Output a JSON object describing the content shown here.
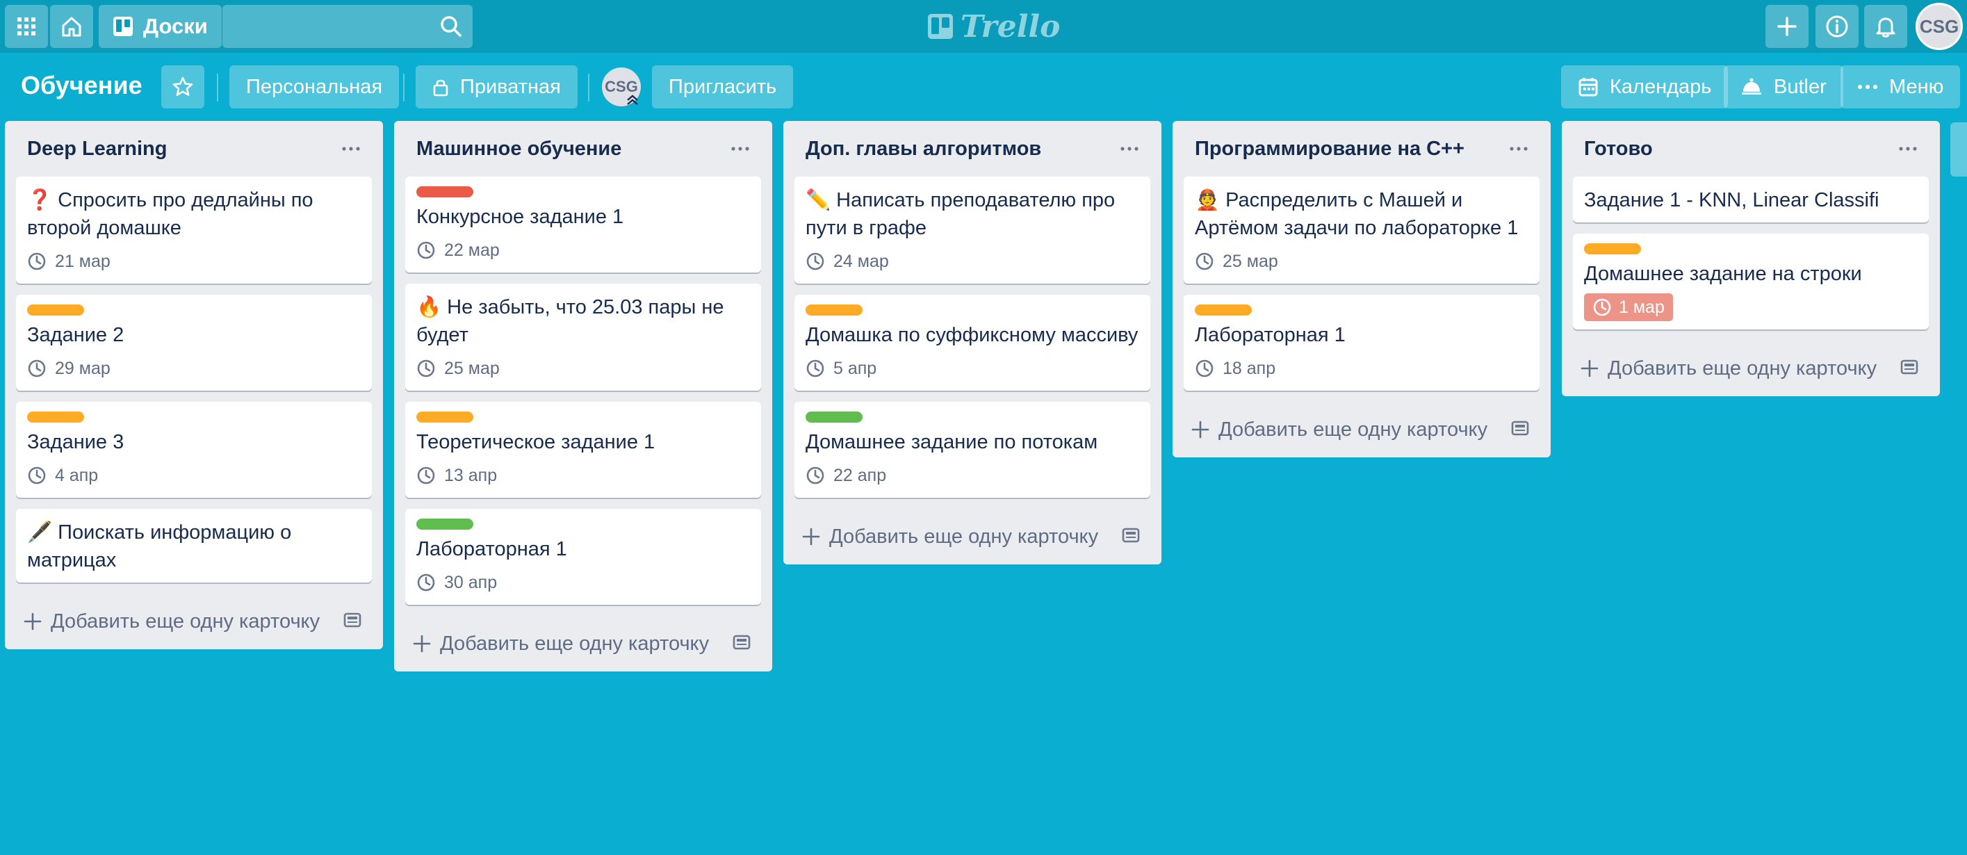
{
  "header": {
    "boards_label": "Доски",
    "search_value": "",
    "logo_text": "Trello",
    "avatar_initials": "CSG"
  },
  "board": {
    "title": "Обучение",
    "team_label": "Персональная",
    "visibility_label": "Приватная",
    "member_initials": "CSG",
    "invite_label": "Пригласить",
    "calendar_label": "Календарь",
    "butler_label": "Butler",
    "menu_label": "Меню"
  },
  "colors": {
    "header_bg": "#089bba",
    "board_bg": "#0aaed0",
    "label_orange": "#ffab25",
    "label_red": "#eb5a46",
    "label_green": "#61bd4f",
    "overdue": "#ec9488"
  },
  "lists": [
    {
      "title": "Deep Learning",
      "add_label": "Добавить еще одну карточку",
      "cards": [
        {
          "title": "❓ Спросить про дедлайны по второй домашке",
          "due": "21 мар",
          "label": ""
        },
        {
          "title": "Задание 2",
          "due": "29 мар",
          "label": "orange"
        },
        {
          "title": "Задание 3",
          "due": "4 апр",
          "label": "orange"
        },
        {
          "title": "🖋️ Поискать информацию о матрицах",
          "due": "",
          "label": ""
        }
      ]
    },
    {
      "title": "Машинное обучение",
      "add_label": "Добавить еще одну карточку",
      "cards": [
        {
          "title": "Конкурсное задание 1",
          "due": "22 мар",
          "label": "red"
        },
        {
          "title": "🔥 Не забыть, что 25.03 пары не будет",
          "due": "25 мар",
          "label": ""
        },
        {
          "title": "Теоретическое задание 1",
          "due": "13 апр",
          "label": "orange"
        },
        {
          "title": "Лабораторная 1",
          "due": "30 апр",
          "label": "green"
        }
      ]
    },
    {
      "title": "Доп. главы алгоритмов",
      "add_label": "Добавить еще одну карточку",
      "cards": [
        {
          "title": "✏️ Написать преподавателю про пути в графе",
          "due": "24 мар",
          "label": ""
        },
        {
          "title": "Домашка по суффиксному массиву",
          "due": "5 апр",
          "label": "orange"
        },
        {
          "title": "Домашнее задание по потокам",
          "due": "22 апр",
          "label": "green"
        }
      ]
    },
    {
      "title": "Программирование на C++",
      "add_label": "Добавить еще одну карточку",
      "cards": [
        {
          "title": "👲 Распределить с Машей и Артёмом задачи по лабораторке 1",
          "due": "25 мар",
          "label": ""
        },
        {
          "title": "Лабораторная 1",
          "due": "18 апр",
          "label": "orange"
        }
      ]
    },
    {
      "title": "Готово",
      "add_label": "Добавить еще одну карточку",
      "cards": [
        {
          "title": "Задание 1 - KNN, Linear Classifi",
          "due": "",
          "label": ""
        },
        {
          "title": "Домашнее задание на строки",
          "due": "1 мар",
          "label": "orange",
          "overdue": true
        }
      ]
    }
  ]
}
